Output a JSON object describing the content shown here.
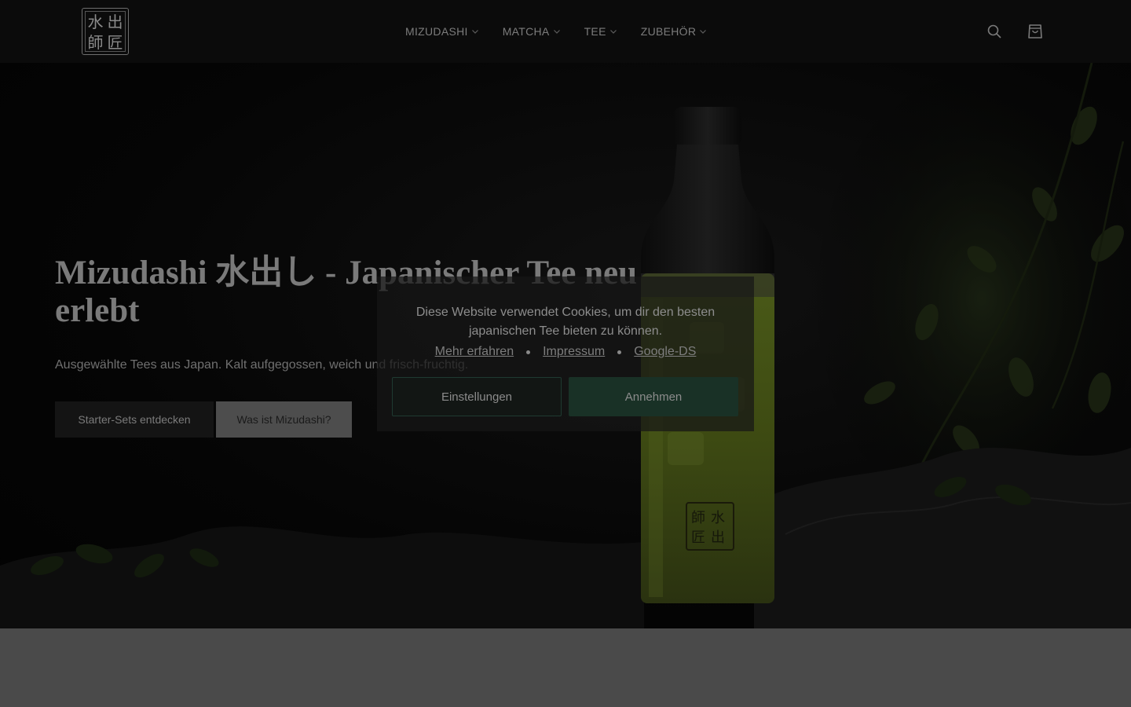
{
  "header": {
    "logo": {
      "chars": [
        "水",
        "出",
        "師",
        "匠"
      ],
      "icon": "mizudashi-shisho-logo"
    },
    "nav": [
      {
        "label": "MIZUDASHI",
        "icon": "chevron-down-icon"
      },
      {
        "label": "MATCHA",
        "icon": "chevron-down-icon"
      },
      {
        "label": "TEE",
        "icon": "chevron-down-icon"
      },
      {
        "label": "ZUBEHÖR",
        "icon": "chevron-down-icon"
      }
    ],
    "icons": [
      "search-icon",
      "cart-icon"
    ]
  },
  "hero": {
    "title": "Mizudashi 水出し - Japanischer Tee neu erlebt",
    "subtitle": "Ausgewählte Tees aus Japan. Kalt aufgegossen, weich und frisch-fruchtig.",
    "primary_button": "Starter-Sets entdecken",
    "secondary_button": "Was ist Mizudashi?",
    "bottle_logo": [
      "水",
      "出",
      "師",
      "匠"
    ]
  },
  "cookie": {
    "text": "Diese Website verwendet Cookies, um dir den besten japanischen Tee bieten zu können.",
    "links": [
      "Mehr erfahren",
      "Impressum",
      "Google-DS"
    ],
    "settings_button": "Einstellungen",
    "accept_button": "Annehmen"
  },
  "colors": {
    "header_bg": "#0b0b0b",
    "overlay": "#4a4a4a",
    "accept_green": "#193126",
    "tea_green": "#3d4a12"
  }
}
